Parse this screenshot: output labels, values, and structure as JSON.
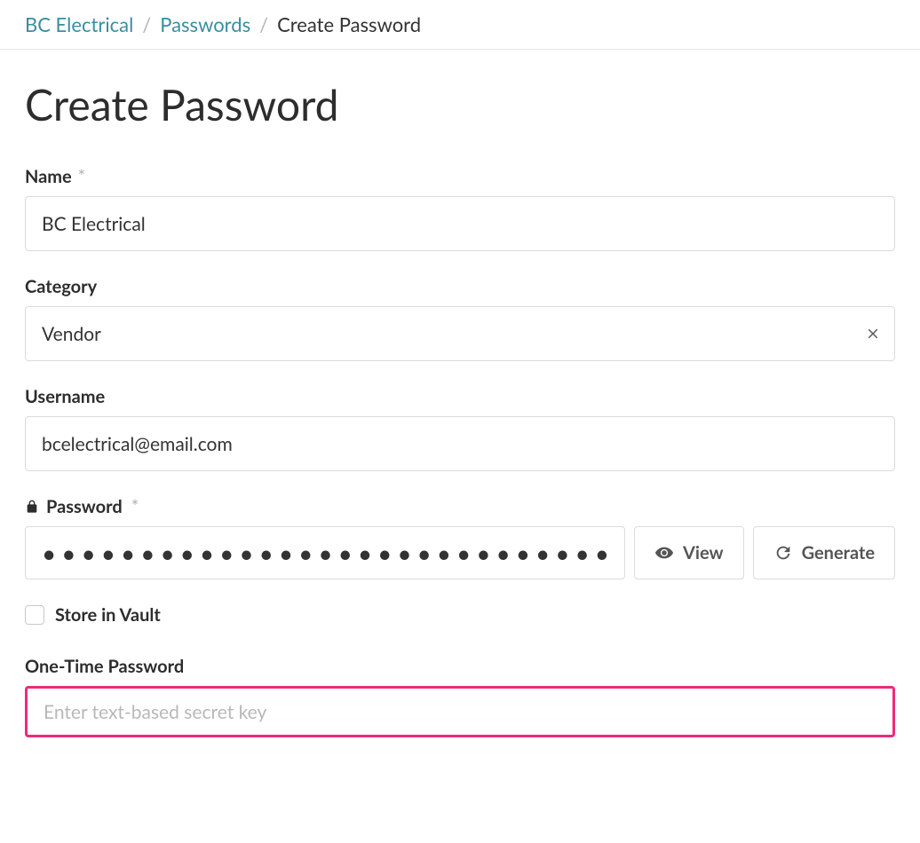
{
  "breadcrumb": {
    "items": [
      {
        "label": "BC Electrical",
        "link": true
      },
      {
        "label": "Passwords",
        "link": true
      },
      {
        "label": "Create Password",
        "link": false
      }
    ]
  },
  "page": {
    "title": "Create Password"
  },
  "form": {
    "name": {
      "label": "Name",
      "required_mark": "*",
      "value": "BC Electrical"
    },
    "category": {
      "label": "Category",
      "value": "Vendor"
    },
    "username": {
      "label": "Username",
      "value": "bcelectrical@email.com"
    },
    "password": {
      "label": "Password",
      "required_mark": "*",
      "masked_value": "••••••••••••••••••••••••••••••",
      "view_label": "View",
      "generate_label": "Generate"
    },
    "store_in_vault": {
      "label": "Store in Vault",
      "checked": false
    },
    "otp": {
      "label": "One-Time Password",
      "placeholder": "Enter text-based secret key",
      "value": ""
    }
  }
}
